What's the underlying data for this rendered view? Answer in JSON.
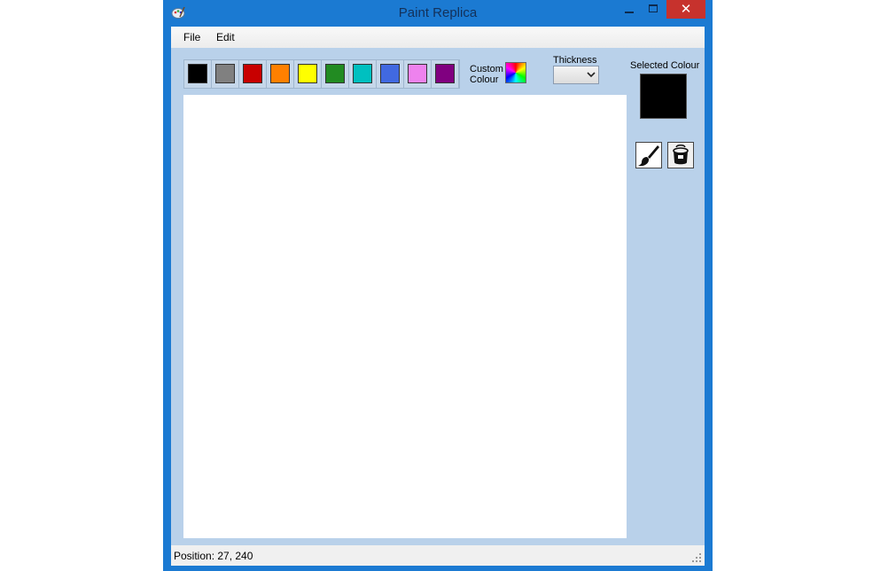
{
  "window": {
    "title": "Paint Replica",
    "close_symbol": "✕"
  },
  "menu": {
    "file": "File",
    "edit": "Edit"
  },
  "palette": [
    {
      "name": "black",
      "color": "#000000"
    },
    {
      "name": "gray",
      "color": "#808080"
    },
    {
      "name": "red",
      "color": "#c80000"
    },
    {
      "name": "orange",
      "color": "#ff8000"
    },
    {
      "name": "yellow",
      "color": "#ffff00"
    },
    {
      "name": "green",
      "color": "#228b22"
    },
    {
      "name": "cyan",
      "color": "#00c0c0"
    },
    {
      "name": "blue",
      "color": "#4169e1"
    },
    {
      "name": "pink",
      "color": "#ee82ee"
    },
    {
      "name": "purple",
      "color": "#800080"
    }
  ],
  "custom_colour": {
    "label_line1": "Custom",
    "label_line2": "Colour",
    "icon": "color-wheel-icon"
  },
  "thickness": {
    "label": "Thickness",
    "value": ""
  },
  "selected_colour": {
    "label": "Selected Colour",
    "color": "#000000"
  },
  "tools": [
    {
      "name": "brush",
      "icon": "paintbrush-icon"
    },
    {
      "name": "fill",
      "icon": "paint-bucket-icon"
    }
  ],
  "status": {
    "position_text": "Position: 27, 240"
  }
}
